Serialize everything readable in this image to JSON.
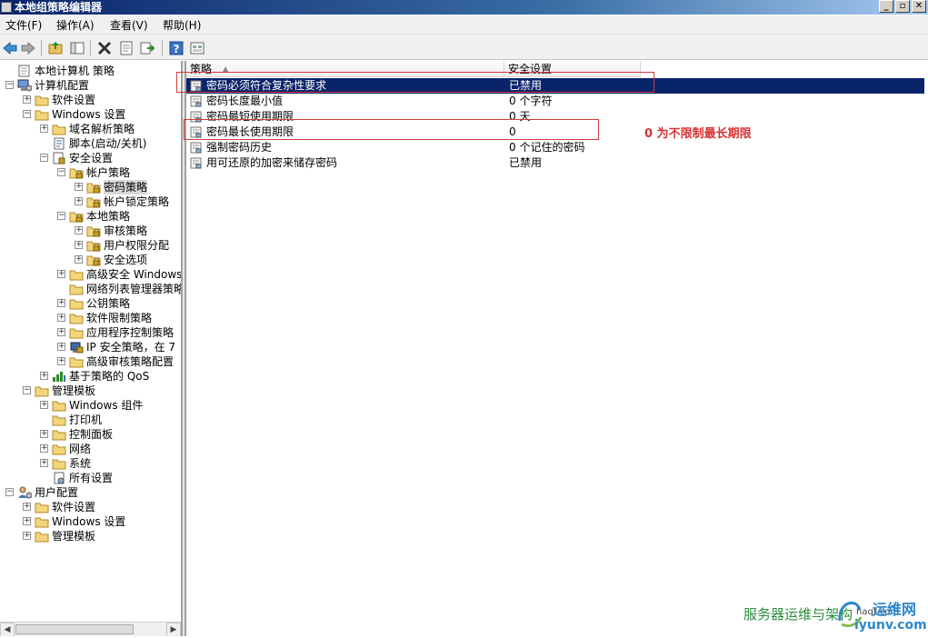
{
  "window": {
    "title": "本地组策略编辑器",
    "buttons": [
      "_",
      "▫",
      "✕"
    ]
  },
  "menu": [
    "文件(F)",
    "操作(A)",
    "查看(V)",
    "帮助(H)"
  ],
  "tree": [
    {
      "label": "本地计算机 策略",
      "level": 0,
      "expander": "",
      "icon": "computer-policy-icon"
    },
    {
      "label": "计算机配置",
      "level": 0,
      "expander": "−",
      "icon": "computer-config-icon"
    },
    {
      "label": "软件设置",
      "level": 1,
      "expander": "+",
      "icon": "folder-icon"
    },
    {
      "label": "Windows 设置",
      "level": 1,
      "expander": "−",
      "icon": "folder-icon"
    },
    {
      "label": "域名解析策略",
      "level": 2,
      "expander": "+",
      "icon": "folder-icon"
    },
    {
      "label": "脚本(启动/关机)",
      "level": 2,
      "expander": "",
      "icon": "script-icon"
    },
    {
      "label": "安全设置",
      "level": 2,
      "expander": "−",
      "icon": "security-icon"
    },
    {
      "label": "帐户策略",
      "level": 3,
      "expander": "−",
      "icon": "folder-lock-icon"
    },
    {
      "label": "密码策略",
      "level": 4,
      "expander": "+",
      "icon": "folder-lock-icon",
      "selected": true
    },
    {
      "label": "帐户锁定策略",
      "level": 4,
      "expander": "+",
      "icon": "folder-lock-icon"
    },
    {
      "label": "本地策略",
      "level": 3,
      "expander": "−",
      "icon": "folder-lock-icon"
    },
    {
      "label": "审核策略",
      "level": 4,
      "expander": "+",
      "icon": "folder-lock-icon"
    },
    {
      "label": "用户权限分配",
      "level": 4,
      "expander": "+",
      "icon": "folder-lock-icon"
    },
    {
      "label": "安全选项",
      "level": 4,
      "expander": "+",
      "icon": "folder-lock-icon"
    },
    {
      "label": "高级安全 Windows",
      "level": 3,
      "expander": "+",
      "icon": "folder-icon"
    },
    {
      "label": "网络列表管理器策略",
      "level": 3,
      "expander": "",
      "icon": "folder-icon"
    },
    {
      "label": "公钥策略",
      "level": 3,
      "expander": "+",
      "icon": "folder-icon"
    },
    {
      "label": "软件限制策略",
      "level": 3,
      "expander": "+",
      "icon": "folder-icon"
    },
    {
      "label": "应用程序控制策略",
      "level": 3,
      "expander": "+",
      "icon": "folder-icon"
    },
    {
      "label": "IP 安全策略，在 7",
      "level": 3,
      "expander": "+",
      "icon": "ip-security-icon"
    },
    {
      "label": "高级审核策略配置",
      "level": 3,
      "expander": "+",
      "icon": "folder-icon"
    },
    {
      "label": "基于策略的 QoS",
      "level": 2,
      "expander": "+",
      "icon": "qos-chart-icon"
    },
    {
      "label": "管理模板",
      "level": 1,
      "expander": "−",
      "icon": "folder-icon"
    },
    {
      "label": "Windows 组件",
      "level": 2,
      "expander": "+",
      "icon": "folder-icon"
    },
    {
      "label": "打印机",
      "level": 2,
      "expander": "",
      "icon": "folder-icon"
    },
    {
      "label": "控制面板",
      "level": 2,
      "expander": "+",
      "icon": "folder-icon"
    },
    {
      "label": "网络",
      "level": 2,
      "expander": "+",
      "icon": "folder-icon"
    },
    {
      "label": "系统",
      "level": 2,
      "expander": "+",
      "icon": "folder-icon"
    },
    {
      "label": "所有设置",
      "level": 2,
      "expander": "",
      "icon": "settings-page-icon"
    },
    {
      "label": "用户配置",
      "level": 0,
      "expander": "−",
      "icon": "user-config-icon"
    },
    {
      "label": "软件设置",
      "level": 1,
      "expander": "+",
      "icon": "folder-icon"
    },
    {
      "label": "Windows 设置",
      "level": 1,
      "expander": "+",
      "icon": "folder-icon"
    },
    {
      "label": "管理模板",
      "level": 1,
      "expander": "+",
      "icon": "folder-icon"
    }
  ],
  "policy_table": {
    "columns": [
      "策略",
      "安全设置"
    ],
    "rows": [
      {
        "policy": "密码必须符合复杂性要求",
        "setting": "已禁用",
        "selected": true
      },
      {
        "policy": "密码长度最小值",
        "setting": "0 个字符"
      },
      {
        "policy": "密码最短使用期限",
        "setting": "0 天"
      },
      {
        "policy": "密码最长使用期限",
        "setting": "0"
      },
      {
        "policy": "强制密码历史",
        "setting": "0 个记住的密码"
      },
      {
        "policy": "用可还原的加密来储存密码",
        "setting": "已禁用"
      }
    ]
  },
  "annotation": {
    "text": "0 为不限制最长期限",
    "color": "#d63232"
  },
  "watermark": {
    "text": "服务器运维与架构",
    "site": "iyunv.com",
    "site_cn": "运维网",
    "small": "haqt.com"
  },
  "colors": {
    "selection": "#0a246a",
    "highlight_box": "#d23c3c",
    "watermark_green": "#2e8b3e"
  }
}
